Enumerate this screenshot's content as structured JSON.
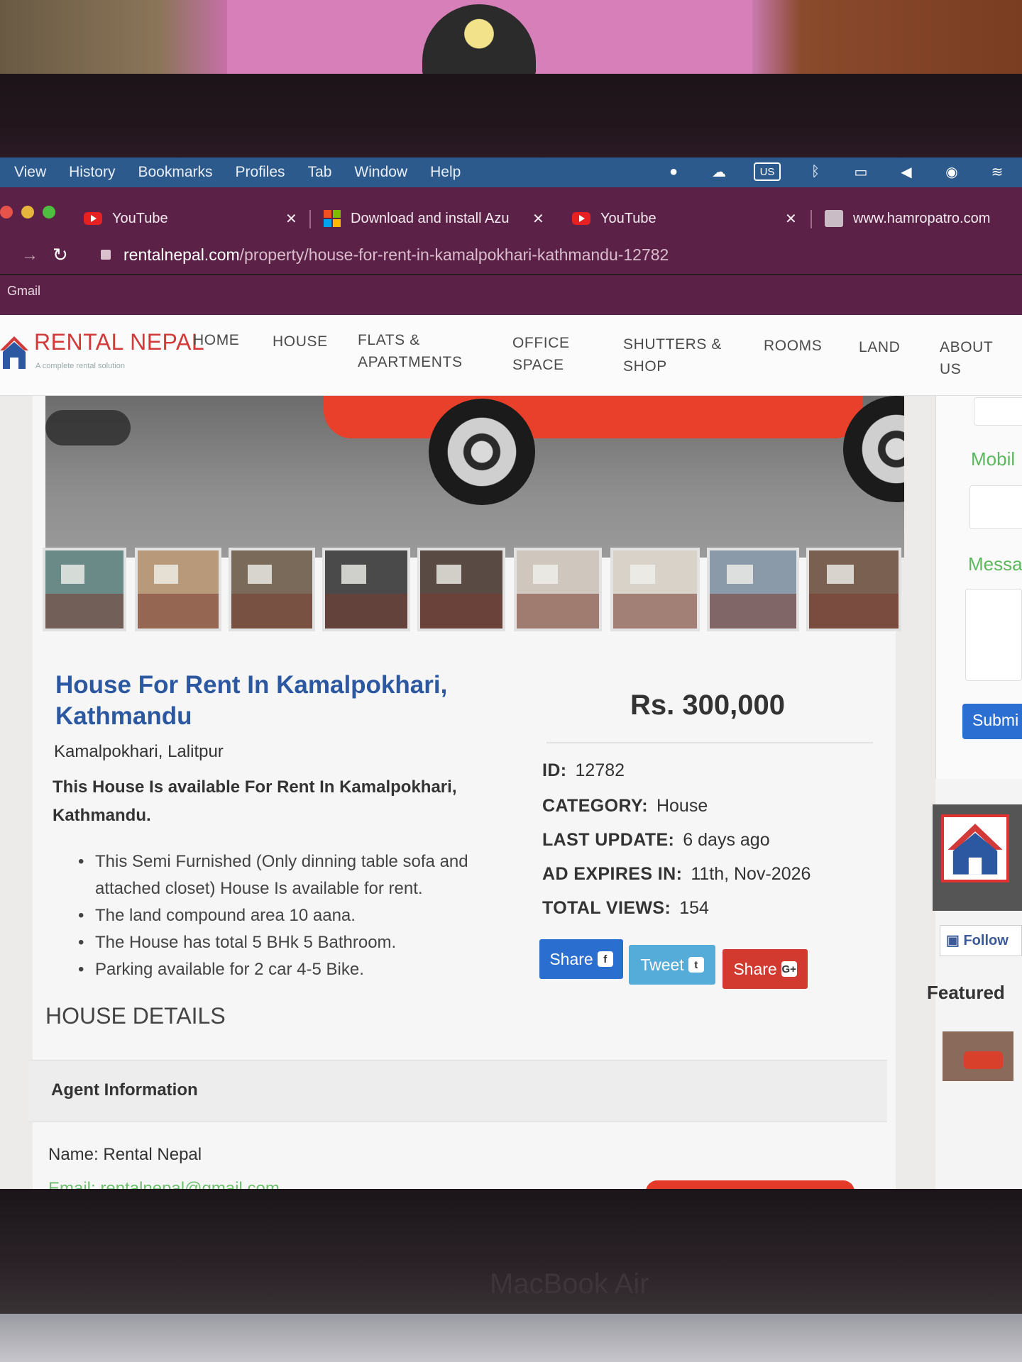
{
  "menubar": {
    "items": [
      "View",
      "History",
      "Bookmarks",
      "Profiles",
      "Tab",
      "Window",
      "Help"
    ],
    "keyboard_layout": "US",
    "status_icons": [
      "notification-icon",
      "cloud-icon",
      "keyboard-layout-icon",
      "bluetooth-icon",
      "display-icon",
      "mute-icon",
      "user-icon",
      "wifi-icon"
    ]
  },
  "tabs": [
    {
      "title": "YouTube",
      "favicon": "youtube-icon"
    },
    {
      "title": "Download and install Azu",
      "favicon": "microsoft-icon"
    },
    {
      "title": "YouTube",
      "favicon": "youtube-icon"
    },
    {
      "title": "www.hamropatro.com",
      "favicon": "hamropatro-icon"
    }
  ],
  "tab_close_glyph": "✕",
  "address": {
    "domain": "rentalnepal.com",
    "path": "/property/house-for-rent-in-kamalpokhari-kathmandu-12782"
  },
  "bookmarks": {
    "first": "Gmail"
  },
  "site": {
    "logo": "RENTAL NEPAL",
    "tagline": "A complete rental solution",
    "nav": [
      {
        "line1": "HOME",
        "line2": ""
      },
      {
        "line1": "HOUSE",
        "line2": ""
      },
      {
        "line1": "FLATS &",
        "line2": "APARTMENTS"
      },
      {
        "line1": "OFFICE",
        "line2": "SPACE"
      },
      {
        "line1": "SHUTTERS &",
        "line2": "SHOP"
      },
      {
        "line1": "ROOMS",
        "line2": ""
      },
      {
        "line1": "LAND",
        "line2": ""
      },
      {
        "line1": "ABOUT",
        "line2": "US"
      }
    ]
  },
  "listing": {
    "title_line1": "House For Rent In Kamalpokhari,",
    "title_line2": "Kathmandu",
    "location": "Kamalpokhari, Lalitpur",
    "intro_line1": "This House Is available For Rent In Kamalpokhari,",
    "intro_line2": "Kathmandu.",
    "bullets": [
      "This Semi Furnished (Only dinning table sofa and",
      "attached closet) House Is available for rent.",
      "The land compound area 10 aana.",
      "The House has total 5 BHk 5 Bathroom.",
      "Parking available for 2 car 4-5 Bike."
    ],
    "details_heading": "HOUSE DETAILS",
    "price": "Rs. 300,000",
    "meta": [
      {
        "label": "ID:",
        "value": "12782"
      },
      {
        "label": "CATEGORY:",
        "value": "House"
      },
      {
        "label": "LAST UPDATE:",
        "value": "6 days ago"
      },
      {
        "label": "AD EXPIRES IN:",
        "value": "11th, Nov-2026"
      },
      {
        "label": "TOTAL VIEWS:",
        "value": "154"
      }
    ],
    "share_buttons": [
      {
        "label": "Share",
        "icon": "f",
        "color": "#2a6fd0"
      },
      {
        "label": "Tweet",
        "icon": "t",
        "color": "#55acd8"
      },
      {
        "label": "Share",
        "icon": "G+",
        "color": "#d23a30"
      }
    ],
    "thumbnail_count": 9
  },
  "agent": {
    "heading": "Agent Information",
    "name": "Name: Rental Nepal",
    "email": "Email: rentalnepal@gmail.com"
  },
  "sidebar": {
    "mobile_label": "Mobil",
    "message_label": "Messa",
    "submit_label": "Submi",
    "follow_label": "Follow",
    "featured_label": "Featured"
  },
  "device_label": "MacBook Air",
  "colors": {
    "brand_red": "#d23a3a",
    "title_blue": "#2b58a0",
    "sidebar_green": "#5cb85c",
    "menubar_blue": "#2c5a8c",
    "browser_chrome": "#5b2146"
  }
}
